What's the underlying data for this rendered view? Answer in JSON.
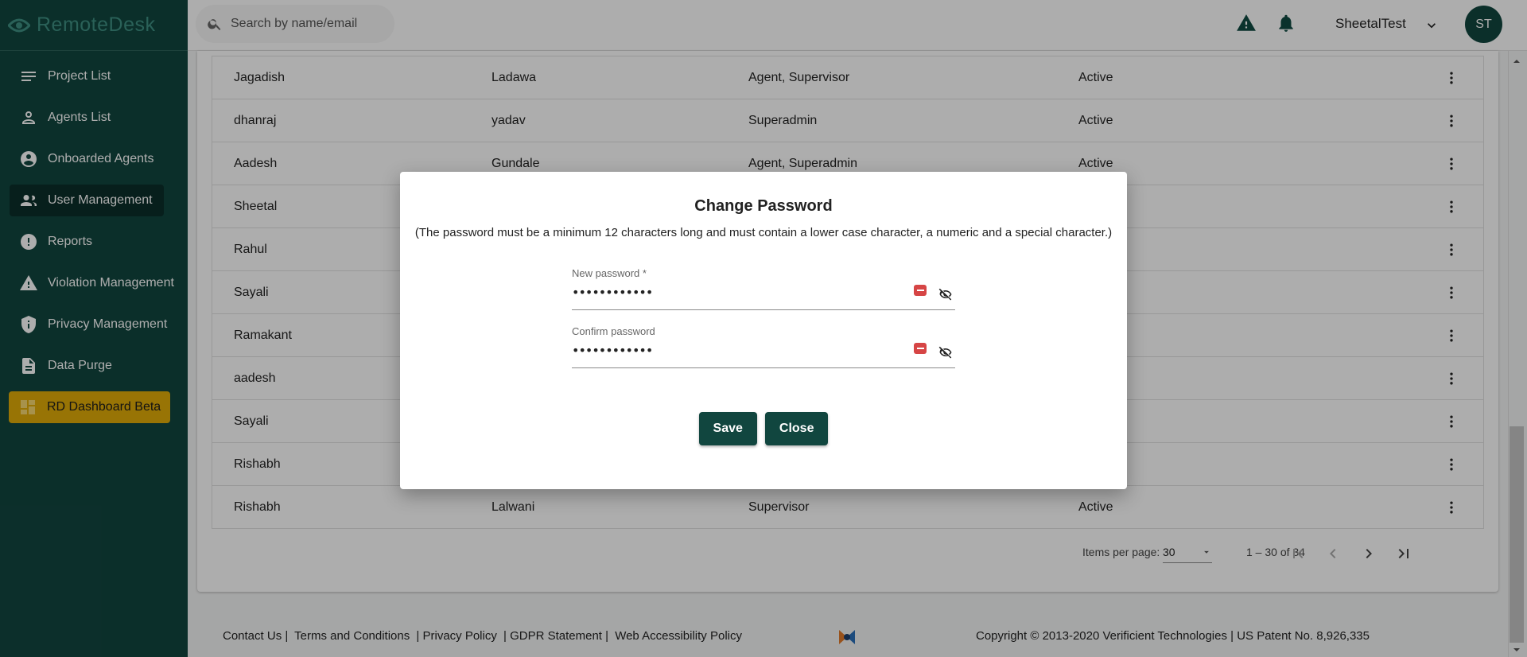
{
  "app": {
    "name": "RemoteDesk"
  },
  "search": {
    "placeholder": "Search by name/email"
  },
  "topbar": {
    "user_name": "SheetalTest",
    "avatar_initials": "ST"
  },
  "sidebar": {
    "items": [
      {
        "label": "Project List",
        "icon": "list-icon"
      },
      {
        "label": "Agents List",
        "icon": "person-icon"
      },
      {
        "label": "Onboarded Agents",
        "icon": "account-circle-icon"
      },
      {
        "label": "User Management",
        "icon": "people-icon",
        "active": true
      },
      {
        "label": "Reports",
        "icon": "alert-circle-icon"
      },
      {
        "label": "Violation Management",
        "icon": "warning-icon"
      },
      {
        "label": "Privacy Management",
        "icon": "shield-icon"
      },
      {
        "label": "Data Purge",
        "icon": "document-icon"
      },
      {
        "label": "RD Dashboard Beta",
        "icon": "dashboard-icon"
      }
    ]
  },
  "table": {
    "rows": [
      {
        "first": "Jagadish",
        "last": "Ladawa",
        "role": "Agent, Supervisor",
        "status": "Active"
      },
      {
        "first": "dhanraj",
        "last": "yadav",
        "role": "Superadmin",
        "status": "Active"
      },
      {
        "first": "Aadesh",
        "last": "Gundale",
        "role": "Agent, Superadmin",
        "status": "Active"
      },
      {
        "first": "Sheetal",
        "last": "",
        "role": "",
        "status": ""
      },
      {
        "first": "Rahul",
        "last": "",
        "role": "",
        "status": ""
      },
      {
        "first": "Sayali",
        "last": "",
        "role": "",
        "status": ""
      },
      {
        "first": "Ramakant",
        "last": "",
        "role": "",
        "status": ""
      },
      {
        "first": "aadesh",
        "last": "",
        "role": "",
        "status": ""
      },
      {
        "first": "Sayali",
        "last": "",
        "role": "",
        "status": ""
      },
      {
        "first": "Rishabh",
        "last": "",
        "role": "",
        "status": ""
      },
      {
        "first": "Rishabh",
        "last": "Lalwani",
        "role": "Supervisor",
        "status": "Active"
      }
    ]
  },
  "paginator": {
    "items_per_page_label": "Items per page:",
    "items_per_page": "30",
    "range": "1 – 30 of 34"
  },
  "footer": {
    "links": [
      "Contact Us |",
      "Terms and Conditions",
      " | Privacy Policy",
      " | GDPR Statement |",
      "Web Accessibility Policy"
    ],
    "copyright": "Copyright © 2013-2020 Verificient Technologies | US Patent No. 8,926,335"
  },
  "modal": {
    "title": "Change Password",
    "note": "(The password must be a minimum 12 characters long and must contain a lower case character, a numeric and a special character.)",
    "new_password_label": "New password *",
    "new_password_value": "••••••••••••",
    "confirm_password_label": "Confirm password",
    "confirm_password_value": "••••••••••••",
    "save_label": "Save",
    "close_label": "Close"
  },
  "colors": {
    "brand": "#11463f",
    "accent": "#e0ac08",
    "danger": "#d64545"
  }
}
